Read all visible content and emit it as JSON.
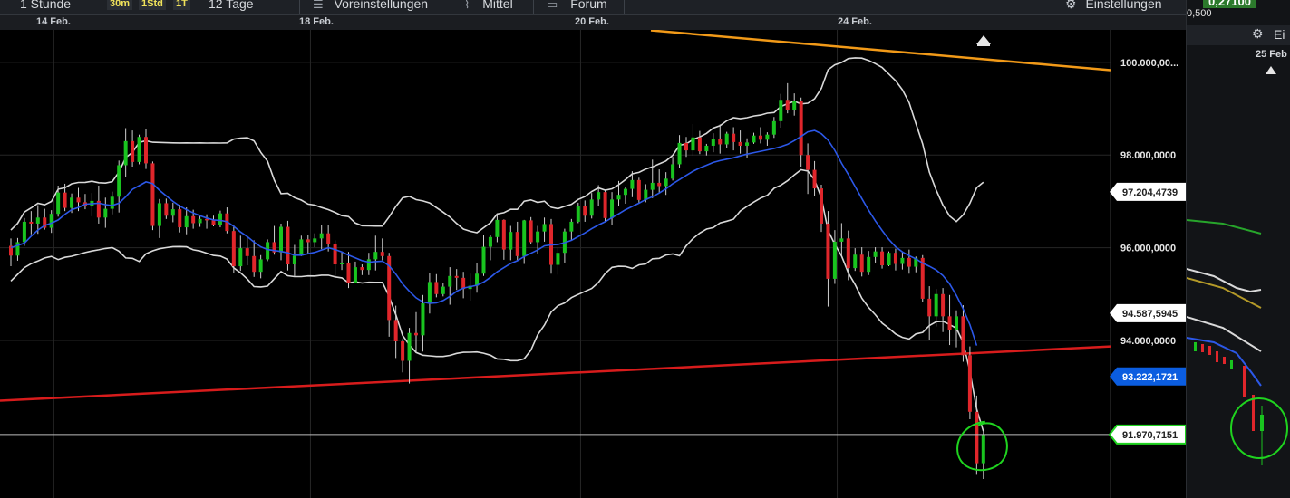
{
  "toolbar": {
    "interval": "1 Stunde",
    "tf_30m": "30m",
    "tf_1std": "1Std",
    "tf_1t": "1T",
    "range": "12 Tage",
    "preferences": "Voreinstellungen",
    "indicators": "Mittel",
    "forum": "Forum",
    "settings": "Einstellungen"
  },
  "dates": [
    "14 Feb.",
    "18 Feb.",
    "20 Feb.",
    "24 Feb."
  ],
  "right_panel": {
    "price_top": "0,27100",
    "price_sub": "0,500",
    "settings": "Ei",
    "date": "25 Feb"
  },
  "colors": {
    "up": "#19c41f",
    "down": "#e0262b",
    "ma": "#2c58e8",
    "band": "#d9d9d9",
    "support": "#d81c1c",
    "resistance": "#f29a18",
    "highlight_badge": "#0b5de0",
    "annotation": "#1fd41f"
  },
  "chart_data": {
    "type": "candlestick",
    "y_ticks": [
      "100.000,00...",
      "98.000,0000",
      "96.000,0000",
      "94.000,0000"
    ],
    "y_tick_values": [
      100000,
      98000,
      96000,
      94000
    ],
    "ylim": [
      90600,
      100700
    ],
    "badges": [
      {
        "label": "97.204,4739",
        "value": 97204.4739,
        "style": "dark"
      },
      {
        "label": "94.587,5945",
        "value": 94587.5945,
        "style": "dark"
      },
      {
        "label": "93.222,1721",
        "value": 93222.1721,
        "style": "blue"
      },
      {
        "label": "91.970,7151",
        "value": 91970.7151,
        "style": "green"
      }
    ],
    "current_price": 91970.7151,
    "x_ticks": [
      "14 Feb.",
      "18 Feb.",
      "20 Feb.",
      "24 Feb."
    ],
    "x_tick_index": [
      3,
      41,
      81,
      119
    ],
    "ohlc": [
      [
        96040,
        96200,
        95600,
        95830
      ],
      [
        95830,
        96210,
        95720,
        96120
      ],
      [
        96120,
        96640,
        96040,
        96560
      ],
      [
        96560,
        96790,
        96290,
        96520
      ],
      [
        96520,
        96920,
        96300,
        96650
      ],
      [
        96650,
        96840,
        96390,
        96430
      ],
      [
        96430,
        96810,
        96320,
        96730
      ],
      [
        96730,
        97340,
        96670,
        97190
      ],
      [
        97190,
        97380,
        96790,
        96860
      ],
      [
        96860,
        97170,
        96750,
        97080
      ],
      [
        97080,
        97290,
        96790,
        96980
      ],
      [
        96980,
        97160,
        96830,
        96890
      ],
      [
        96890,
        97180,
        96680,
        97010
      ],
      [
        97010,
        97340,
        96520,
        96650
      ],
      [
        96650,
        97080,
        96430,
        96840
      ],
      [
        96840,
        97210,
        96720,
        97100
      ],
      [
        97100,
        97880,
        96760,
        97780
      ],
      [
        97780,
        98580,
        97530,
        98300
      ],
      [
        98300,
        98530,
        97750,
        97850
      ],
      [
        97850,
        98440,
        97800,
        98390
      ],
      [
        98390,
        98550,
        97700,
        97820
      ],
      [
        97820,
        97860,
        96380,
        96470
      ],
      [
        96470,
        97050,
        96210,
        96960
      ],
      [
        96960,
        97060,
        96620,
        96690
      ],
      [
        96690,
        96970,
        96550,
        96830
      ],
      [
        96830,
        96930,
        96330,
        96440
      ],
      [
        96440,
        96870,
        96290,
        96680
      ],
      [
        96680,
        96820,
        96410,
        96530
      ],
      [
        96530,
        96700,
        96450,
        96620
      ],
      [
        96620,
        96720,
        96410,
        96590
      ],
      [
        96590,
        96690,
        96460,
        96500
      ],
      [
        96500,
        96800,
        96440,
        96740
      ],
      [
        96740,
        96870,
        96310,
        96360
      ],
      [
        96360,
        96480,
        95460,
        95600
      ],
      [
        95600,
        96260,
        95500,
        95990
      ],
      [
        95990,
        96210,
        95620,
        95820
      ],
      [
        95820,
        96160,
        95370,
        95480
      ],
      [
        95480,
        95840,
        95340,
        95750
      ],
      [
        95750,
        96180,
        95710,
        96120
      ],
      [
        96120,
        96470,
        95850,
        95900
      ],
      [
        95900,
        96520,
        95730,
        96450
      ],
      [
        96450,
        96580,
        95510,
        95640
      ],
      [
        95640,
        96060,
        95390,
        95830
      ],
      [
        95830,
        96260,
        95820,
        96180
      ],
      [
        96180,
        96280,
        95870,
        96120
      ],
      [
        96120,
        96310,
        96010,
        96200
      ],
      [
        96200,
        96490,
        95970,
        96310
      ],
      [
        96310,
        96480,
        95920,
        96090
      ],
      [
        96090,
        96160,
        95370,
        95640
      ],
      [
        95640,
        95910,
        95520,
        95680
      ],
      [
        95680,
        95910,
        95130,
        95240
      ],
      [
        95240,
        95700,
        95230,
        95580
      ],
      [
        95580,
        95640,
        95410,
        95520
      ],
      [
        95520,
        95890,
        95410,
        95750
      ],
      [
        95750,
        96260,
        95510,
        95910
      ],
      [
        95910,
        96200,
        95730,
        95820
      ],
      [
        95820,
        95890,
        94080,
        94440
      ],
      [
        94440,
        94750,
        93620,
        93980
      ],
      [
        93980,
        94030,
        93310,
        93560
      ],
      [
        93560,
        94270,
        93070,
        94160
      ],
      [
        94160,
        94610,
        93730,
        94110
      ],
      [
        94110,
        94980,
        93760,
        94800
      ],
      [
        94800,
        95450,
        94580,
        95260
      ],
      [
        95260,
        95430,
        94930,
        95000
      ],
      [
        95000,
        95240,
        94950,
        95160
      ],
      [
        95160,
        95580,
        94770,
        95390
      ],
      [
        95390,
        95540,
        95090,
        95350
      ],
      [
        95350,
        95480,
        94910,
        95110
      ],
      [
        95110,
        95440,
        94860,
        95180
      ],
      [
        95180,
        95670,
        95030,
        95440
      ],
      [
        95440,
        96270,
        95390,
        96020
      ],
      [
        96020,
        96280,
        95730,
        96230
      ],
      [
        96230,
        96730,
        96120,
        96600
      ],
      [
        96600,
        96610,
        95740,
        95960
      ],
      [
        95960,
        96470,
        95730,
        96340
      ],
      [
        96340,
        96560,
        95730,
        95820
      ],
      [
        95820,
        96600,
        95650,
        96590
      ],
      [
        96590,
        96660,
        96080,
        96120
      ],
      [
        96120,
        96470,
        95860,
        96350
      ],
      [
        96350,
        96650,
        96130,
        96510
      ],
      [
        96510,
        96620,
        95440,
        95630
      ],
      [
        95630,
        96000,
        95420,
        95890
      ],
      [
        95890,
        96410,
        95680,
        96350
      ],
      [
        96350,
        96620,
        96170,
        96560
      ],
      [
        96560,
        96970,
        96530,
        96890
      ],
      [
        96890,
        97020,
        96560,
        96690
      ],
      [
        96690,
        97180,
        96630,
        97040
      ],
      [
        97040,
        97350,
        96900,
        97200
      ],
      [
        97200,
        97260,
        96550,
        96640
      ],
      [
        96640,
        97200,
        96490,
        97040
      ],
      [
        97040,
        97440,
        96900,
        97140
      ],
      [
        97140,
        97320,
        96950,
        97270
      ],
      [
        97270,
        97650,
        97090,
        97460
      ],
      [
        97460,
        97510,
        96970,
        97030
      ],
      [
        97030,
        97370,
        96980,
        97250
      ],
      [
        97250,
        97900,
        97070,
        97400
      ],
      [
        97400,
        97690,
        97180,
        97330
      ],
      [
        97330,
        97630,
        97140,
        97490
      ],
      [
        97490,
        97960,
        97450,
        97800
      ],
      [
        97800,
        98430,
        97720,
        98260
      ],
      [
        98260,
        98390,
        97960,
        98100
      ],
      [
        98100,
        98670,
        97990,
        98380
      ],
      [
        98380,
        98520,
        98020,
        98080
      ],
      [
        98080,
        98240,
        97990,
        98200
      ],
      [
        98200,
        98470,
        98060,
        98350
      ],
      [
        98350,
        98660,
        98030,
        98230
      ],
      [
        98230,
        98500,
        98150,
        98460
      ],
      [
        98460,
        98600,
        98100,
        98280
      ],
      [
        98280,
        98530,
        98030,
        98200
      ],
      [
        98200,
        98360,
        97940,
        98270
      ],
      [
        98270,
        98480,
        98240,
        98420
      ],
      [
        98420,
        98600,
        98250,
        98330
      ],
      [
        98330,
        98490,
        98200,
        98440
      ],
      [
        98440,
        98820,
        98370,
        98730
      ],
      [
        98730,
        99320,
        98590,
        99190
      ],
      [
        99190,
        99550,
        98900,
        98970
      ],
      [
        98970,
        99330,
        98850,
        99160
      ],
      [
        99160,
        99240,
        97750,
        98000
      ],
      [
        98000,
        98250,
        97160,
        97680
      ],
      [
        97680,
        97870,
        97110,
        97280
      ],
      [
        97280,
        97360,
        96340,
        96520
      ],
      [
        96520,
        96790,
        94730,
        95330
      ],
      [
        95330,
        96380,
        95220,
        96130
      ],
      [
        96130,
        96530,
        95830,
        96200
      ],
      [
        96200,
        96370,
        95300,
        95560
      ],
      [
        95560,
        95990,
        95500,
        95850
      ],
      [
        95850,
        96010,
        95380,
        95480
      ],
      [
        95480,
        95930,
        95410,
        95800
      ],
      [
        95800,
        96010,
        95680,
        95920
      ],
      [
        95920,
        96010,
        95550,
        95620
      ],
      [
        95620,
        95920,
        95600,
        95890
      ],
      [
        95890,
        95980,
        95510,
        95650
      ],
      [
        95650,
        95910,
        95530,
        95780
      ],
      [
        95780,
        95960,
        95440,
        95590
      ],
      [
        95590,
        95810,
        95470,
        95780
      ],
      [
        95780,
        95840,
        94820,
        94900
      ],
      [
        94900,
        95170,
        94000,
        94520
      ],
      [
        94520,
        95110,
        94300,
        95000
      ],
      [
        95000,
        95130,
        94180,
        94520
      ],
      [
        94520,
        94980,
        93900,
        94230
      ],
      [
        94230,
        94650,
        93850,
        94520
      ],
      [
        94520,
        94760,
        93540,
        93680
      ],
      [
        93680,
        93870,
        92300,
        92460
      ],
      [
        92460,
        92810,
        91100,
        91350
      ],
      [
        91350,
        92040,
        91010,
        91970
      ]
    ],
    "ma": [
      96000,
      96050,
      96100,
      96250,
      96380,
      96480,
      96530,
      96600,
      96720,
      96820,
      96870,
      96940,
      96950,
      96960,
      96930,
      96910,
      96960,
      97100,
      97260,
      97340,
      97420,
      97380,
      97240,
      97120,
      97000,
      96900,
      96820,
      96750,
      96690,
      96640,
      96600,
      96590,
      96560,
      96460,
      96340,
      96240,
      96120,
      96020,
      95960,
      95940,
      95920,
      95890,
      95840,
      95840,
      95870,
      95900,
      95950,
      96000,
      95960,
      95910,
      95840,
      95780,
      95720,
      95690,
      95700,
      95710,
      95610,
      95430,
      95220,
      95060,
      94920,
      94830,
      94800,
      94810,
      94860,
      94950,
      95060,
      95130,
      95160,
      95190,
      95260,
      95360,
      95480,
      95570,
      95660,
      95720,
      95810,
      95880,
      95950,
      96040,
      96060,
      96070,
      96110,
      96160,
      96240,
      96320,
      96410,
      96490,
      96560,
      96650,
      96730,
      96820,
      96890,
      96960,
      97040,
      97100,
      97180,
      97270,
      97380,
      97470,
      97560,
      97650,
      97720,
      97780,
      97840,
      97880,
      97910,
      97940,
      97980,
      98020,
      98050,
      98080,
      98110,
      98140,
      98180,
      98230,
      98310,
      98400,
      98500,
      98530,
      98460,
      98320,
      98100,
      97820,
      97580,
      97320,
      97060,
      96810,
      96580,
      96370,
      96180,
      96020,
      95910,
      95830,
      95760,
      95670,
      95600,
      95520,
      95400,
      95220,
      94970,
      94680,
      94340,
      93890
    ]
  }
}
